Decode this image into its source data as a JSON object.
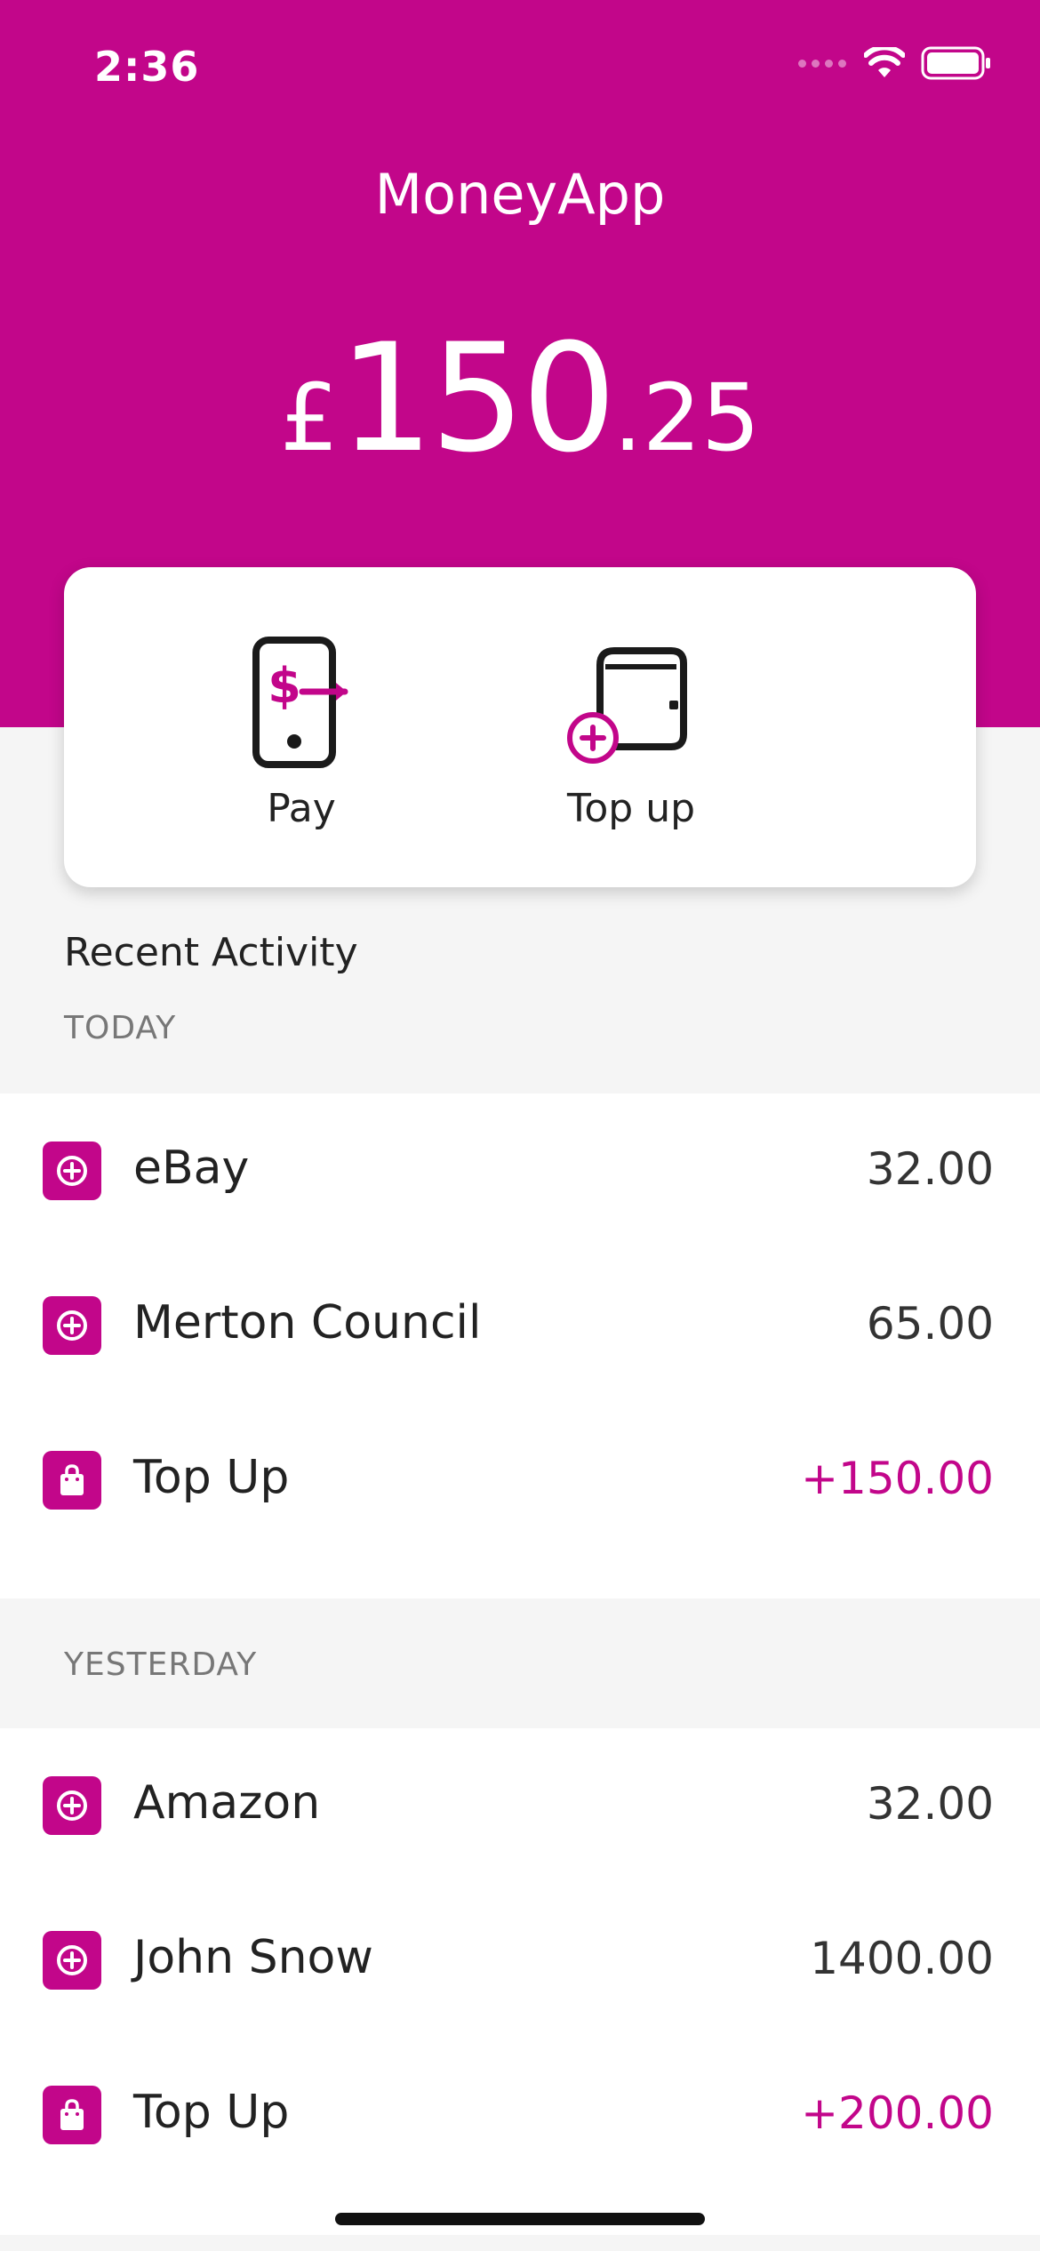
{
  "status": {
    "time": "2:36"
  },
  "app": {
    "title": "MoneyApp"
  },
  "balance": {
    "currency": "£",
    "integer": "150",
    "decimal": ".25"
  },
  "actions": [
    {
      "label": "Pay",
      "icon": "phone-pay-icon"
    },
    {
      "label": "Top up",
      "icon": "wallet-add-icon"
    }
  ],
  "activity": {
    "title": "Recent Activity",
    "groups": [
      {
        "label": "TODAY",
        "items": [
          {
            "name": "eBay",
            "amount": "32.00",
            "type": "payment",
            "icon": "plus-circle-icon"
          },
          {
            "name": "Merton Council",
            "amount": "65.00",
            "type": "payment",
            "icon": "plus-circle-icon"
          },
          {
            "name": "Top Up",
            "amount": "+150.00",
            "type": "credit",
            "icon": "shopping-bag-icon"
          }
        ]
      },
      {
        "label": "YESTERDAY",
        "items": [
          {
            "name": "Amazon",
            "amount": "32.00",
            "type": "payment",
            "icon": "plus-circle-icon"
          },
          {
            "name": "John Snow",
            "amount": "1400.00",
            "type": "payment",
            "icon": "plus-circle-icon"
          },
          {
            "name": "Top Up",
            "amount": "+200.00",
            "type": "credit",
            "icon": "shopping-bag-icon"
          }
        ]
      }
    ]
  },
  "colors": {
    "brand": "#c2068a",
    "background": "#f5f5f5",
    "card": "#ffffff"
  }
}
